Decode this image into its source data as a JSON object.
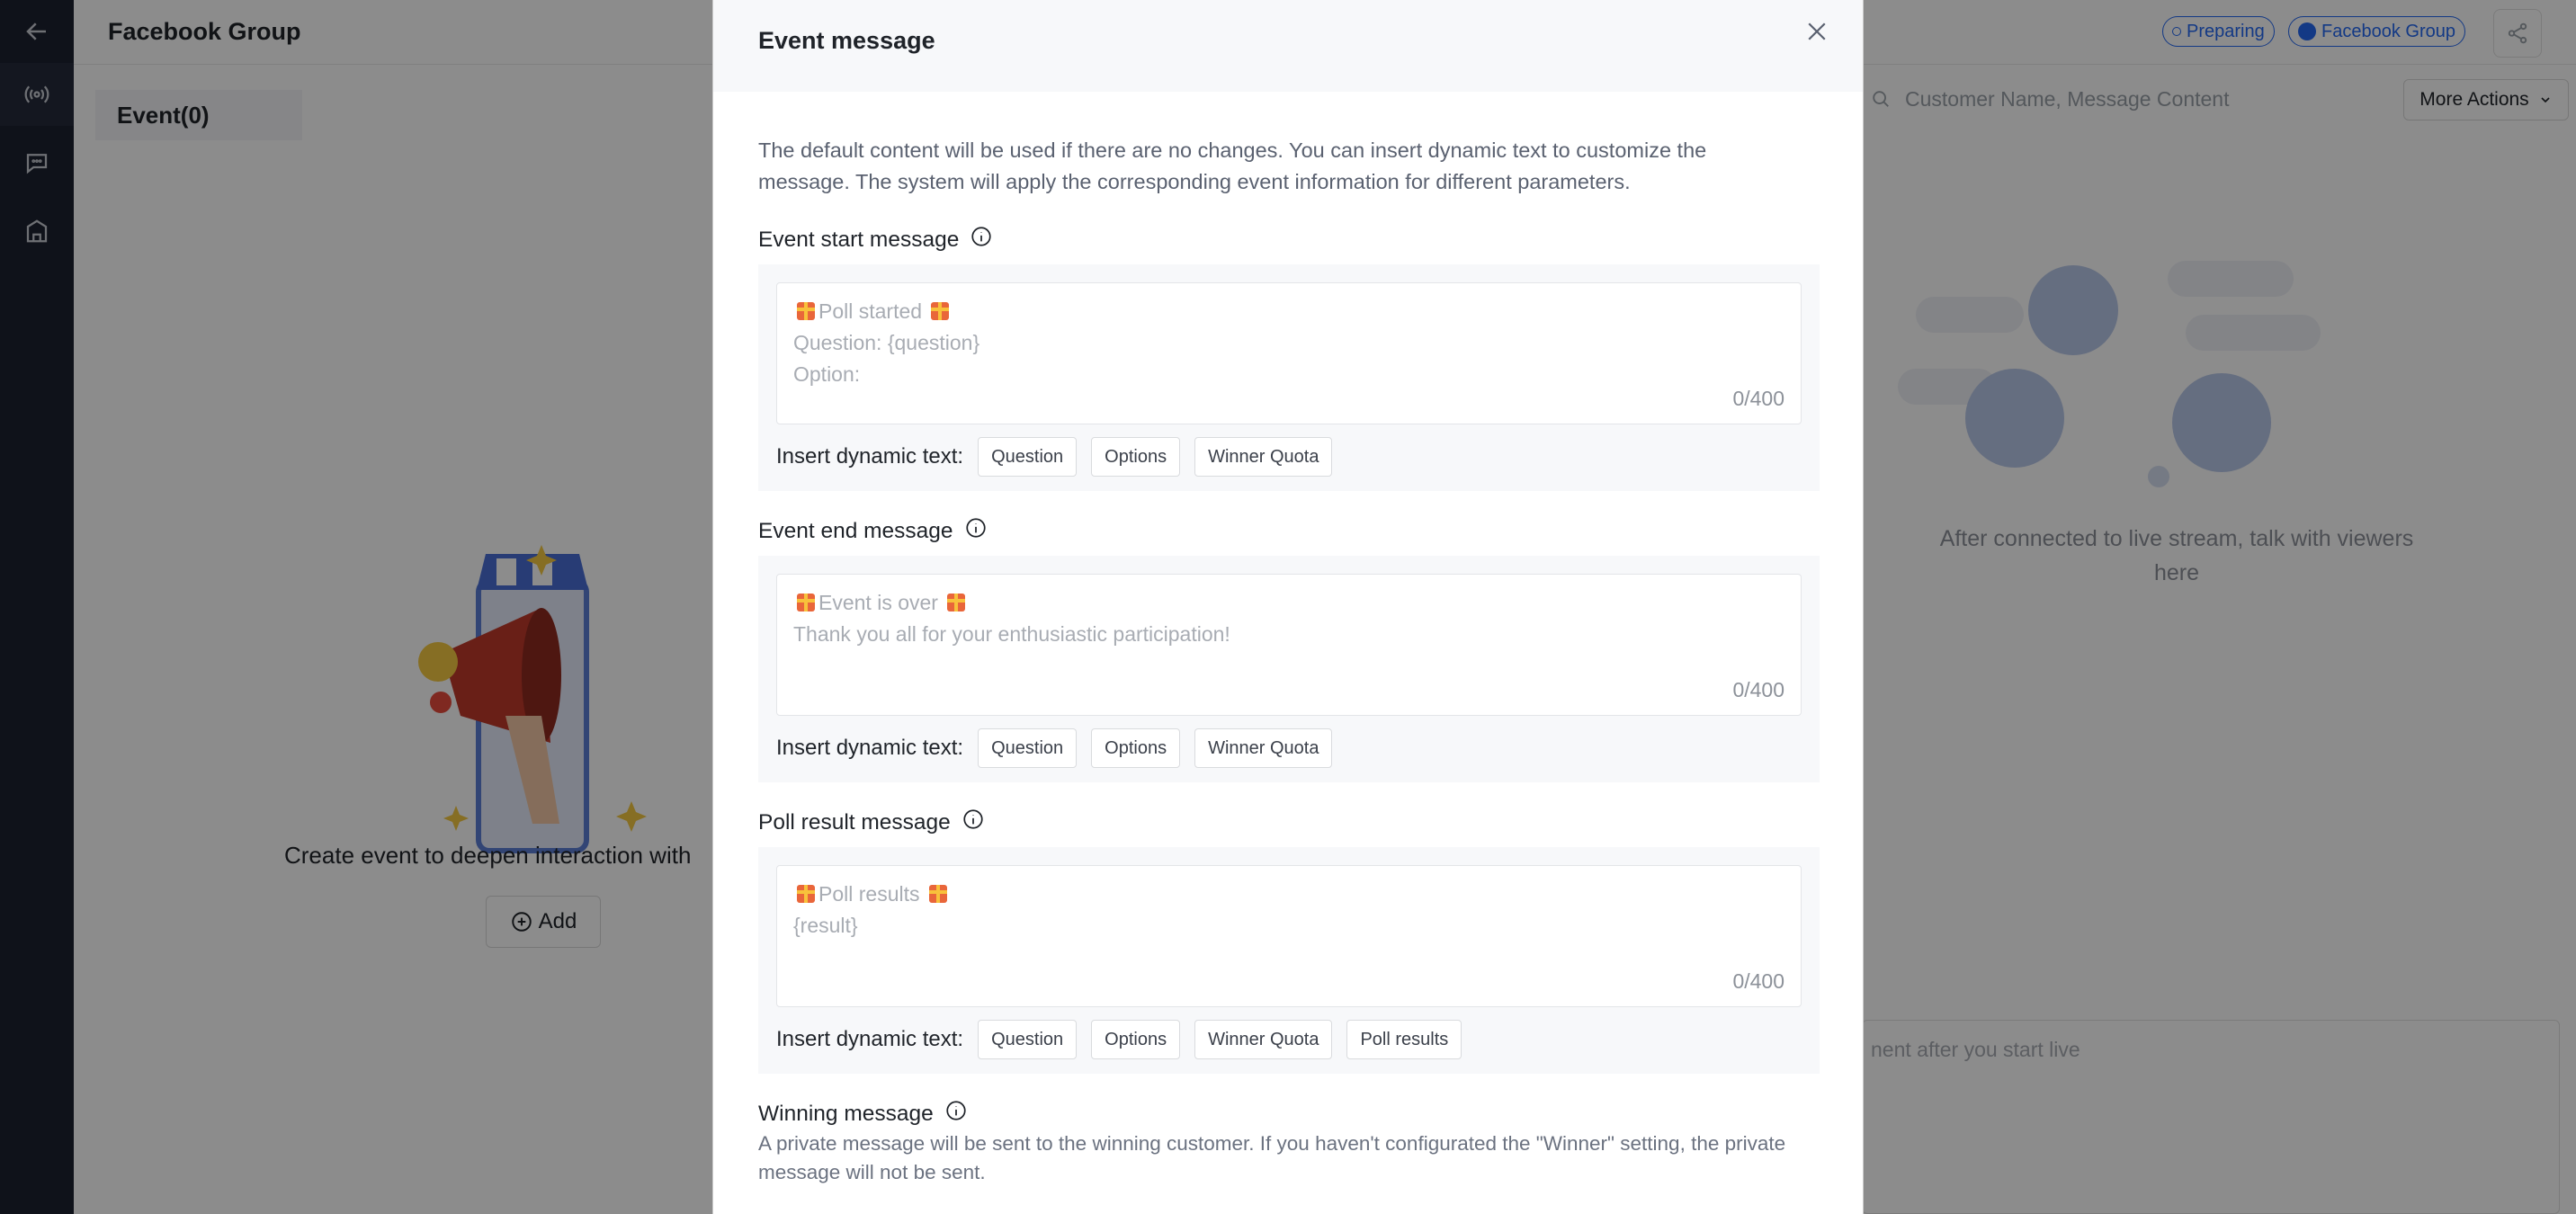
{
  "header": {
    "title": "Facebook Group",
    "status_badge": "Preparing",
    "platform_badge": "Facebook Group"
  },
  "left": {
    "tab_label": "Event(0)",
    "empty_text": "Create event to deepen interaction with",
    "add_label": "Add"
  },
  "right": {
    "search_placeholder": "Customer Name, Message Content",
    "more_actions": "More Actions",
    "empty_text": "After connected to live stream, talk with viewers here",
    "comment_placeholder": "nent after you start live"
  },
  "modal": {
    "title": "Event message",
    "description": "The default content will be used if there are no changes. You can insert dynamic text to customize the message. The system will apply the corresponding event information for different parameters.",
    "insert_label": "Insert dynamic text:",
    "sections": [
      {
        "label": "Event start message",
        "lines": [
          "Poll started",
          "Question: {question}",
          "Option:"
        ],
        "counter": "0/400",
        "chips": [
          "Question",
          "Options",
          "Winner Quota"
        ]
      },
      {
        "label": "Event end message",
        "lines": [
          "Event is over",
          "Thank you all for your enthusiastic participation!"
        ],
        "counter": "0/400",
        "chips": [
          "Question",
          "Options",
          "Winner Quota"
        ]
      },
      {
        "label": "Poll result message",
        "lines": [
          "Poll results",
          "{result}"
        ],
        "counter": "0/400",
        "chips": [
          "Question",
          "Options",
          "Winner Quota",
          "Poll results"
        ]
      }
    ],
    "winning": {
      "label": "Winning message",
      "description": "A private message will be sent to the winning customer. If you haven't configurated the \"Winner\" setting, the private message will not be sent."
    }
  },
  "colors": {
    "rail": "#1d2130",
    "accent": "#2468f2",
    "overlay": "rgba(0,0,0,0.45)"
  }
}
